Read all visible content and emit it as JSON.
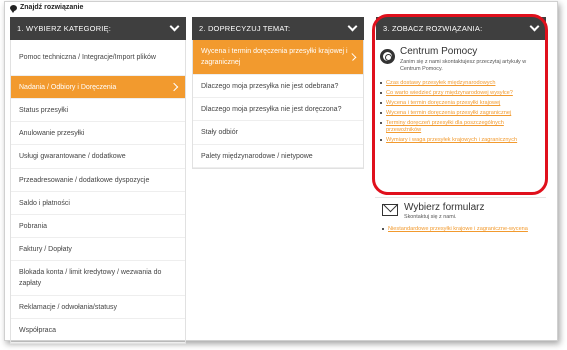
{
  "page_title": "Znajdź rozwiązanie",
  "columns": [
    {
      "header": "1. WYBIERZ KATEGORIĘ:",
      "items": [
        {
          "label": "Pomoc techniczna / Integracje/Import plików",
          "active": false
        },
        {
          "label": "Nadania / Odbiory i Doręczenia",
          "active": true
        },
        {
          "label": "Status przesyłki",
          "active": false
        },
        {
          "label": "Anulowanie przesyłki",
          "active": false
        },
        {
          "label": "Usługi gwarantowane / dodatkowe",
          "active": false
        },
        {
          "label": "Przeadresowanie / dodatkowe dyspozycje",
          "active": false
        },
        {
          "label": "Saldo i płatności",
          "active": false
        },
        {
          "label": "Pobrania",
          "active": false
        },
        {
          "label": "Faktury / Dopłaty",
          "active": false
        },
        {
          "label": "Blokada konta / limit kredytowy / wezwania do zapłaty",
          "active": false
        },
        {
          "label": "Reklamacje / odwołania/statusy",
          "active": false
        },
        {
          "label": "Współpraca",
          "active": false
        }
      ]
    },
    {
      "header": "2. DOPRECYZUJ TEMAT:",
      "items": [
        {
          "label": "Wycena i termin doręczenia przesyłki krajowej i zagranicznej",
          "active": true
        },
        {
          "label": "Dlaczego moja przesyłka nie jest odebrana?",
          "active": false
        },
        {
          "label": "Dlaczego moja przesyłka nie jest doręczona?",
          "active": false
        },
        {
          "label": "Stały odbiór",
          "active": false
        },
        {
          "label": "Palety międzynarodowe / nietypowe",
          "active": false
        }
      ]
    },
    {
      "header": "3. ZOBACZ ROZWIĄZANIA:"
    }
  ],
  "help_center": {
    "icon": "lifebuoy-icon",
    "title": "Centrum Pomocy",
    "subtitle": "Zanim się z nami skontaktujesz przeczytaj artykuły w Centrum Pomocy.",
    "links": [
      "Czas dostawy przesyłek międzynarodowych",
      "Co warto wiedzieć przy międzynarodowej wysyłce?",
      "Wycena i termin doręczenia przesyłki krajowej",
      "Wycena i termin doręczenia przesyłki zagranicznej",
      "Terminy doręczeń przesyłki dla poszczególnych przewoźników",
      "Wymiary i waga przesyłek krajowych i zagranicznych"
    ]
  },
  "form": {
    "icon": "envelope-icon",
    "title": "Wybierz formularz",
    "subtitle": "Skontaktuj się z nami.",
    "link": "Niestandardowe przesyłki krajowe i zagraniczne-wycena"
  },
  "colors": {
    "header_bg": "#3f3f3f",
    "accent": "#f29a2e",
    "highlight_ring": "#e0101c"
  }
}
